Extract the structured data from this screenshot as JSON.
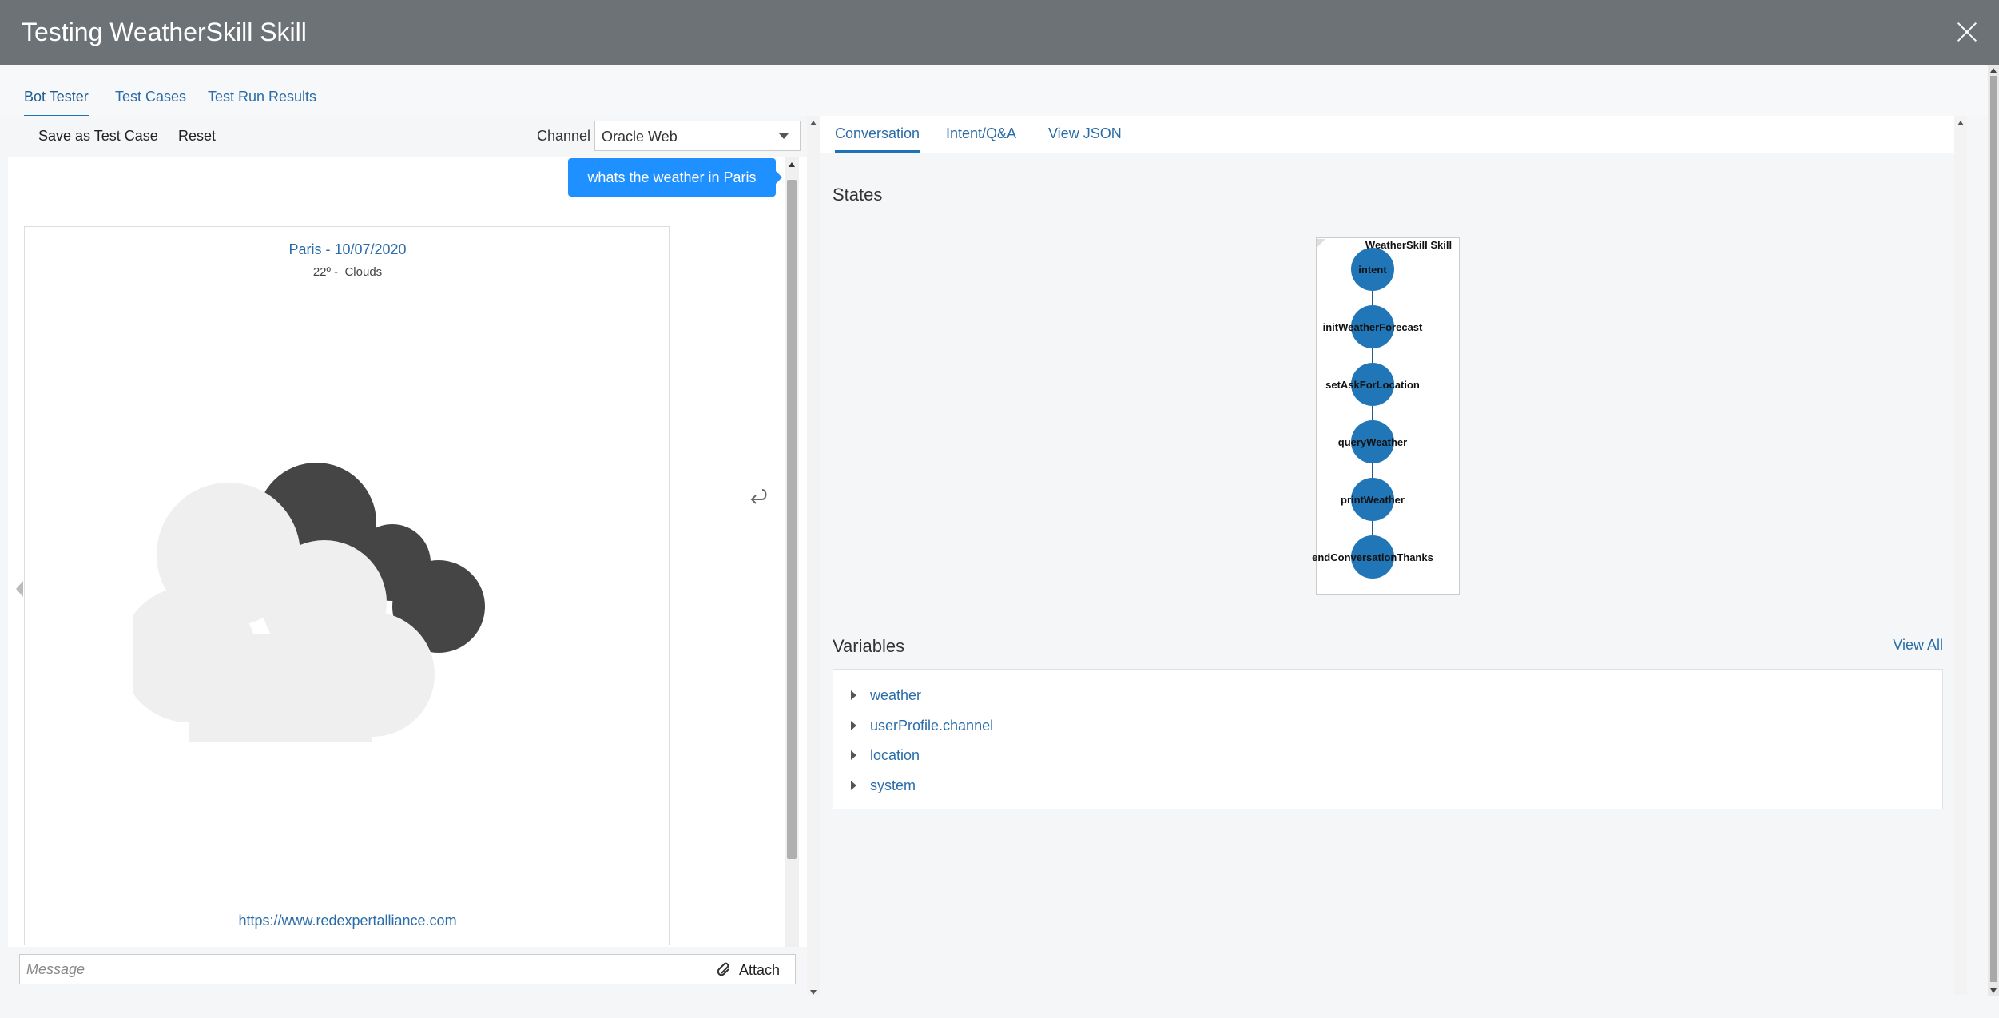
{
  "window": {
    "title": "Testing WeatherSkill Skill",
    "close_icon": "close-icon"
  },
  "main_tabs": [
    {
      "label": "Bot Tester",
      "active": true
    },
    {
      "label": "Test Cases",
      "active": false
    },
    {
      "label": "Test Run Results",
      "active": false
    }
  ],
  "toolbar": {
    "save_label": "Save as Test Case",
    "reset_label": "Reset",
    "channel_label": "Channel",
    "channel_value": "Oracle Web"
  },
  "chat": {
    "user_message": "whats the weather in Paris",
    "card": {
      "title": "Paris - 10/07/2020",
      "subtitle": "22º -  Clouds",
      "image_icon": "cloudy-weather-icon",
      "link": "https://www.redexpertalliance.com"
    },
    "redo_icon": "undo-arrow-icon"
  },
  "compose": {
    "placeholder": "Message",
    "attach_label": "Attach",
    "attach_icon": "paperclip-icon"
  },
  "sub_tabs": [
    {
      "label": "Conversation",
      "active": true
    },
    {
      "label": "Intent/Q&A",
      "active": false
    },
    {
      "label": "View JSON",
      "active": false
    }
  ],
  "states": {
    "title": "States",
    "flow_title": "WeatherSkill Skill",
    "nodes": [
      "intent",
      "initWeatherForecast",
      "setAskForLocation",
      "queryWeather",
      "printWeather",
      "endConversationThanks"
    ]
  },
  "variables": {
    "title": "Variables",
    "view_all": "View All",
    "items": [
      "weather",
      "userProfile.channel",
      "location",
      "system"
    ]
  },
  "colors": {
    "accent": "#1e73b8",
    "bubble": "#1e90ff",
    "titlebar": "#6c7275",
    "node": "#2176b8"
  }
}
